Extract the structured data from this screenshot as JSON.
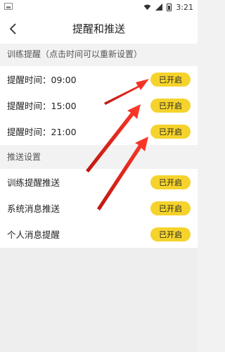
{
  "status_bar": {
    "time": "3:21",
    "icons": [
      "image-icon",
      "wifi-icon",
      "signal-icon",
      "battery-icon"
    ]
  },
  "header": {
    "title": "提醒和推送",
    "back_icon": "chevron-left-icon"
  },
  "sections": [
    {
      "title": "训练提醒（点击时间可以重新设置）",
      "items": [
        {
          "label": "提醒时间：09:00",
          "status": "已开启"
        },
        {
          "label": "提醒时间：15:00",
          "status": "已开启"
        },
        {
          "label": "提醒时间：21:00",
          "status": "已开启"
        }
      ]
    },
    {
      "title": "推送设置",
      "items": [
        {
          "label": "训练提醒推送",
          "status": "已开启"
        },
        {
          "label": "系统消息推送",
          "status": "已开启"
        },
        {
          "label": "个人消息提醒",
          "status": "已开启"
        }
      ]
    }
  ],
  "colors": {
    "accent": "#f5d32c",
    "annotation_arrow": "#e0231b",
    "background": "#f2f2f2"
  }
}
